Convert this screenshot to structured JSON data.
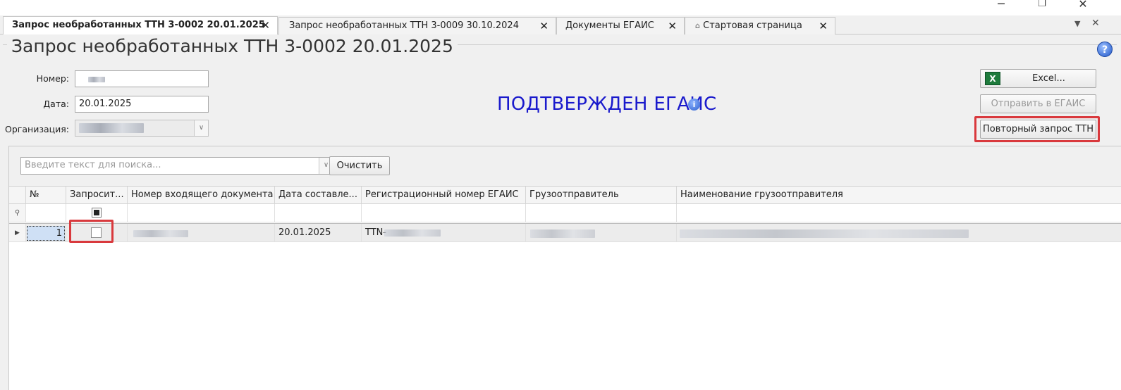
{
  "window": {
    "minimize_glyph": "─",
    "restore_glyph": "❐",
    "close_glyph": "✕"
  },
  "tabs": [
    {
      "label": "Запрос необработанных ТТН 3-0002 20.01.2025",
      "active": true
    },
    {
      "label": "Запрос необработанных ТТН 3-0009 30.10.2024",
      "active": false
    },
    {
      "label": "Документы ЕГАИС",
      "active": false
    },
    {
      "label": "Стартовая страница",
      "active": false,
      "icon": "home-icon"
    }
  ],
  "tab_close_glyph": "✕",
  "tab_menu": {
    "dropdown_glyph": "▼",
    "close_glyph": "✕"
  },
  "page": {
    "title": "Запрос необработанных ТТН 3-0002 20.01.2025",
    "status": "ПОДТВЕРЖДЕН ЕГАИС",
    "help_glyph": "?",
    "info_glyph": "i"
  },
  "form": {
    "number_label": "Номер:",
    "number_value": "",
    "date_label": "Дата:",
    "date_value": "20.01.2025",
    "org_label": "Организация:",
    "org_value": ""
  },
  "buttons": {
    "excel": "Excel...",
    "send_egais": "Отправить в ЕГАИС",
    "repeat_request": "Повторный запрос ТТН",
    "clear": "Очистить"
  },
  "search": {
    "placeholder": "Введите текст для поиска..."
  },
  "grid": {
    "columns": [
      "№",
      "Запросит...",
      "Номер входящего документа",
      "Дата составле...",
      "Регистрационный номер ЕГАИС",
      "Грузоотправитель",
      "Наименование грузоотправителя"
    ],
    "filter_row_icon": "pin-icon",
    "rows": [
      {
        "no": "1",
        "requested": false,
        "incoming_doc": "",
        "date": "20.01.2025",
        "egais_reg": "TTN-",
        "shipper": "",
        "shipper_name": ""
      }
    ]
  },
  "colors": {
    "accent_status": "#1a1acc",
    "highlight": "#d9393d"
  }
}
